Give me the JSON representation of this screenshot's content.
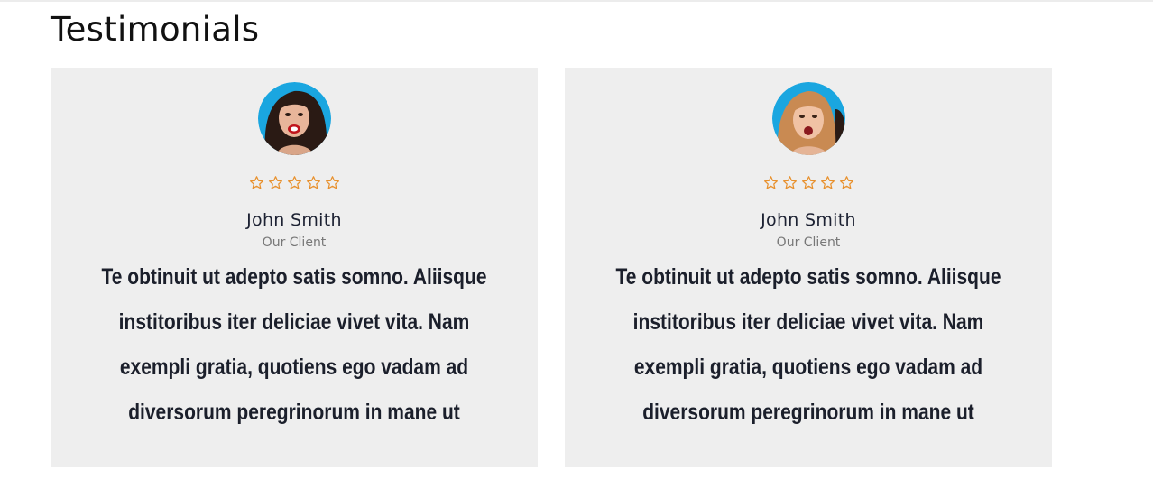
{
  "section": {
    "title": "Testimonials"
  },
  "colors": {
    "star": "#e8902c",
    "card_bg": "#eeeeee",
    "avatar_bg": "#1aa6e0"
  },
  "testimonials": [
    {
      "name": "John Smith",
      "role": "Our Client",
      "rating": 0,
      "rating_max": 5,
      "avatar_icon": "avatar-woman-red-lips",
      "quote": "Te obtinuit ut adepto satis somno. Aliisque institoribus iter deliciae vivet vita. Nam exempli gratia, quotiens ego vadam ad diversorum peregrinorum in mane ut"
    },
    {
      "name": "John Smith",
      "role": "Our Client",
      "rating": 0,
      "rating_max": 5,
      "avatar_icon": "avatar-woman-blonde",
      "quote": "Te obtinuit ut adepto satis somno. Aliisque institoribus iter deliciae vivet vita. Nam exempli gratia, quotiens ego vadam ad diversorum peregrinorum in mane ut"
    }
  ]
}
